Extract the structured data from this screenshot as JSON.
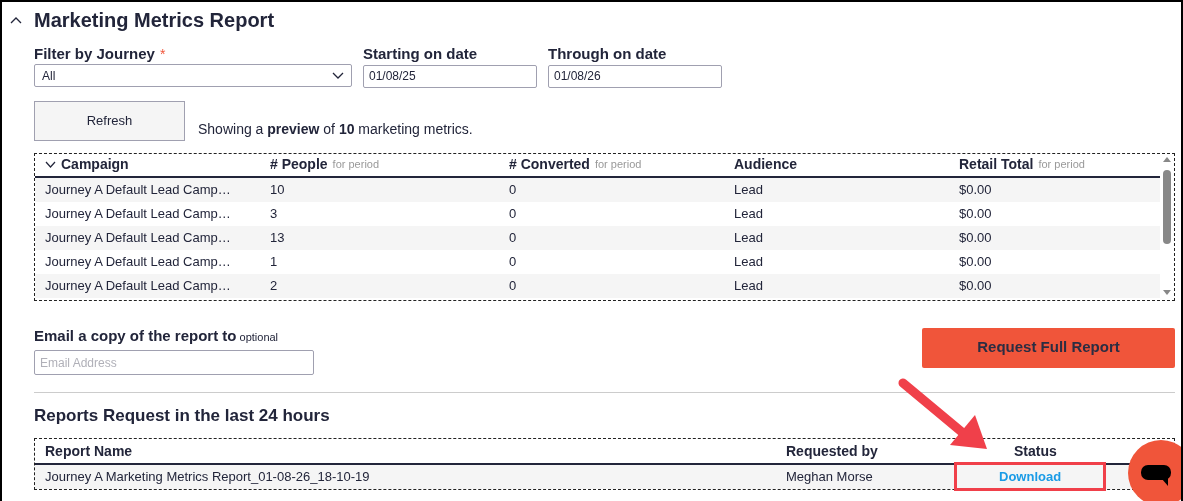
{
  "section": {
    "title": "Marketing Metrics Report",
    "expanded": true
  },
  "required_symbol": "*",
  "filters": [
    {
      "kind": "select",
      "label": "Filter by Journey",
      "required": true,
      "value": "All"
    },
    {
      "kind": "date",
      "label": "Starting on date",
      "required": false,
      "value": "01/08/25"
    },
    {
      "kind": "date",
      "label": "Through on date",
      "required": false,
      "value": "01/08/26"
    }
  ],
  "refresh_button": "Refresh",
  "preview_text": "Showing a **preview** of **10** marketing metrics.",
  "metrics_table": {
    "columns": [
      {
        "label": "Campaign",
        "sorted": true
      },
      {
        "label": "# People",
        "hint": "for period",
        "sorted": false
      },
      {
        "label": "# Converted",
        "hint": "for period",
        "sorted": false
      },
      {
        "label": "Audience",
        "sorted": false
      },
      {
        "label": "Retail Total",
        "hint": "for period",
        "sorted": false
      }
    ],
    "rows": [
      [
        "Journey A Default Lead Camp…",
        "10",
        "0",
        "Lead",
        "$0.00"
      ],
      [
        "Journey A Default Lead Camp…",
        "3",
        "0",
        "Lead",
        "$0.00"
      ],
      [
        "Journey A Default Lead Camp…",
        "13",
        "0",
        "Lead",
        "$0.00"
      ],
      [
        "Journey A Default Lead Camp…",
        "1",
        "0",
        "Lead",
        "$0.00"
      ],
      [
        "Journey A Default Lead Camp…",
        "2",
        "0",
        "Lead",
        "$0.00"
      ]
    ]
  },
  "email": {
    "label": "Email a copy of the report to",
    "hint": "optional",
    "placeholder": "Email Address"
  },
  "request_button": "Request Full Report",
  "reports": {
    "title": "Reports Request in the last 24 hours",
    "columns": [
      "Report Name",
      "Requested by",
      "Status"
    ],
    "rows": [
      {
        "name": "Journey A Marketing Metrics Report_01-08-26_18-10-19",
        "requested_by": "Meghan Morse",
        "status": "Download",
        "highlighted": true
      }
    ]
  }
}
